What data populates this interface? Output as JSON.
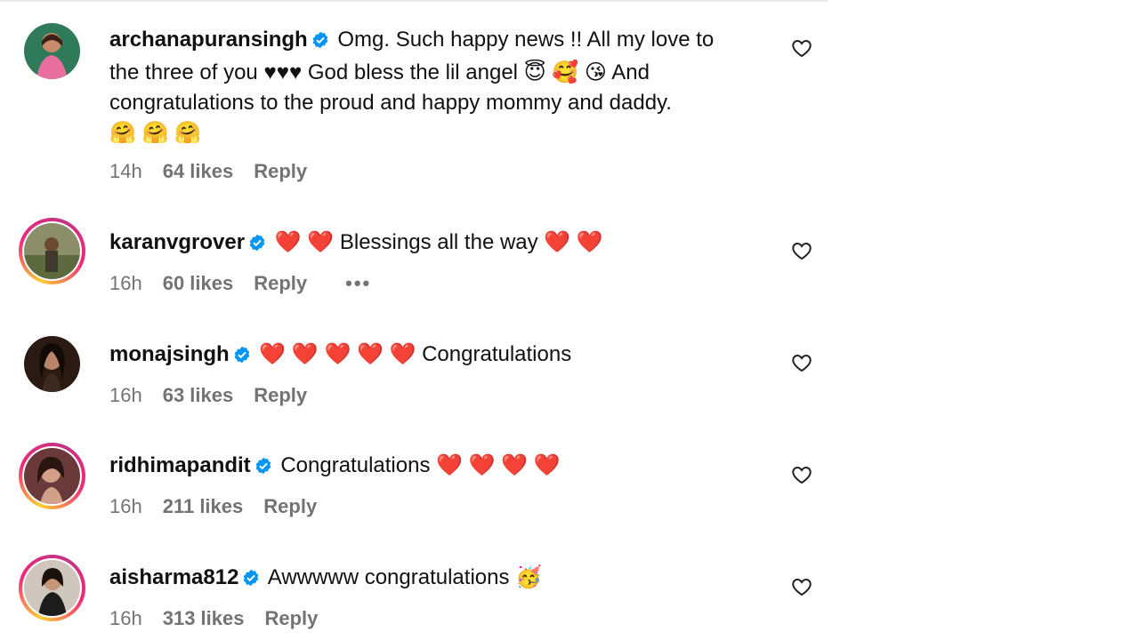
{
  "comments": [
    {
      "username": "archanapuransingh",
      "verified": true,
      "text_lines": [
        "Omg. Such happy news !! All my love to",
        "the three of you ♥♥♥ God bless the lil angel 😇 🥰 😘 And",
        "congratulations to the proud and happy mommy and daddy.",
        "🤗 🤗 🤗"
      ],
      "time": "14h",
      "likes": "64 likes",
      "reply": "Reply",
      "story_ring": false
    },
    {
      "username": "karanvgrover",
      "verified": true,
      "text": "❤️ ❤️ Blessings all the way ❤️ ❤️",
      "time": "16h",
      "likes": "60 likes",
      "reply": "Reply",
      "more": "•••",
      "story_ring": true
    },
    {
      "username": "monajsingh",
      "verified": true,
      "text": "❤️ ❤️ ❤️ ❤️ ❤️ Congratulations",
      "time": "16h",
      "likes": "63 likes",
      "reply": "Reply",
      "story_ring": false
    },
    {
      "username": "ridhimapandit",
      "verified": true,
      "text": "Congratulations ❤️ ❤️ ❤️ ❤️",
      "time": "16h",
      "likes": "211 likes",
      "reply": "Reply",
      "story_ring": true
    },
    {
      "username": "aisharma812",
      "verified": true,
      "text": "Awwwww congratulations 🥳",
      "time": "16h",
      "likes": "313 likes",
      "reply": "Reply",
      "story_ring": true
    }
  ],
  "colors": {
    "verified": "#0095f6",
    "meta_text": "#737373",
    "heart_emoji": "#e8242f"
  },
  "icons": {
    "like": "heart-outline-icon",
    "verified": "verified-badge-icon"
  }
}
